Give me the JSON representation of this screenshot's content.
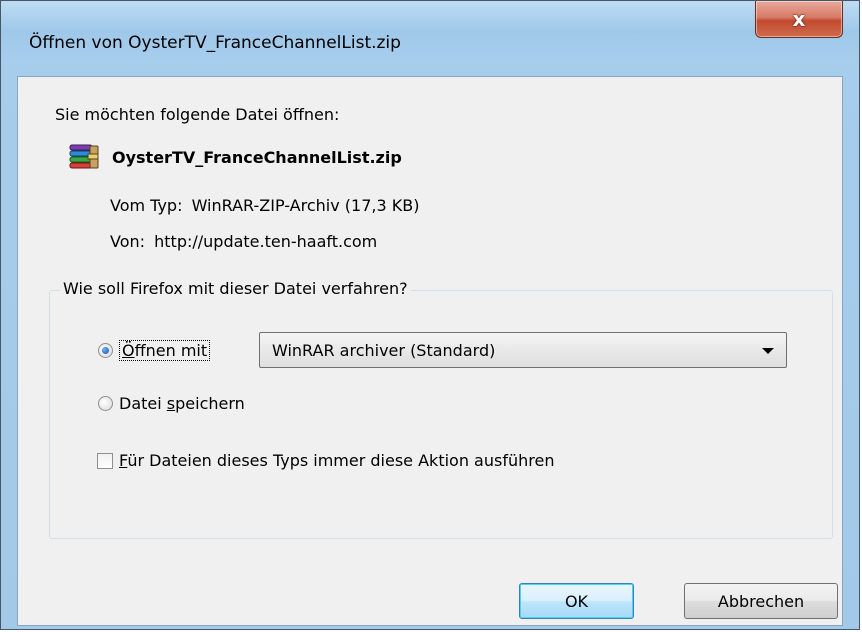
{
  "window": {
    "title": "Öffnen von OysterTV_FranceChannelList.zip",
    "close_glyph": "x"
  },
  "dialog": {
    "intro": "Sie möchten folgende Datei öffnen:",
    "file": {
      "icon": "winrar-archive-icon",
      "name": "OysterTV_FranceChannelList.zip"
    },
    "type_label": "Vom Typ:",
    "type_value": "WinRAR-ZIP-Archiv (17,3 KB)",
    "from_label": "Von:",
    "from_value": "http://update.ten-haaft.com"
  },
  "action_group": {
    "legend": "Wie soll Firefox mit dieser Datei verfahren?",
    "open_with": {
      "label_mnemonic": "Ö",
      "label_rest": "ffnen mit",
      "checked": true
    },
    "app_select": {
      "value": "WinRAR archiver (Standard)"
    },
    "save_file": {
      "label_pre": "Datei ",
      "label_mnemonic": "s",
      "label_post": "peichern",
      "checked": false
    },
    "always": {
      "label_mnemonic": "F",
      "label_rest": "ür Dateien dieses Typs immer diese Aktion ausführen",
      "checked": false
    }
  },
  "buttons": {
    "ok": "OK",
    "cancel": "Abbrechen"
  },
  "colors": {
    "titlebar": "#a3c9e9",
    "client_bg": "#f0f0f0",
    "close_red": "#c24b2f",
    "default_button_border": "#3c7fb1"
  }
}
